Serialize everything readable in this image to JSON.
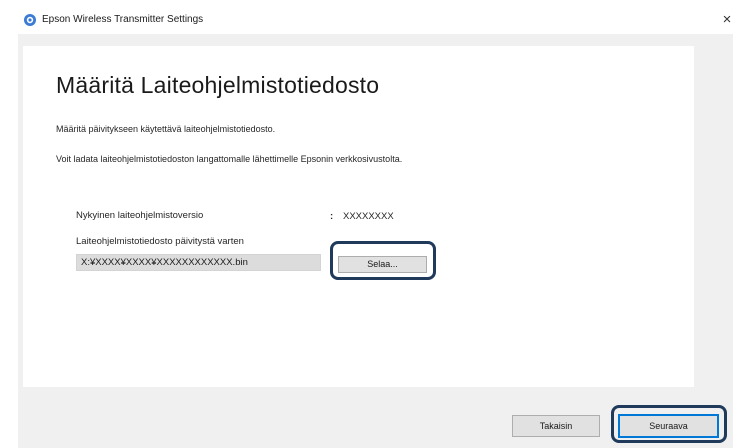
{
  "window": {
    "title": "Epson Wireless Transmitter Settings",
    "close_label": "×"
  },
  "page": {
    "heading": "Määritä Laiteohjelmistotiedosto",
    "description_1": "Määritä päivitykseen käytettävä laiteohjelmistotiedosto.",
    "description_2": "Voit ladata laiteohjelmistotiedoston langattomalle lähettimelle Epsonin verkkosivustolta."
  },
  "firmware": {
    "current_version_label": "Nykyinen laiteohjelmistoversio",
    "current_version_separator": ":",
    "current_version_value": "XXXXXXXX",
    "file_label": "Laiteohjelmistotiedosto päivitystä varten",
    "file_path": "X:¥XXXX¥XXXX¥XXXXXXXXXXXX.bin",
    "browse_label": "Selaa..."
  },
  "footer": {
    "back_label": "Takaisin",
    "next_label": "Seuraava"
  },
  "colors": {
    "accent": "#0078d7",
    "highlight_outline": "#203a5c",
    "window_background": "#f0f0f0",
    "panel_background": "#ffffff"
  },
  "icons": {
    "app": "epson-app-icon",
    "close": "close-icon"
  }
}
